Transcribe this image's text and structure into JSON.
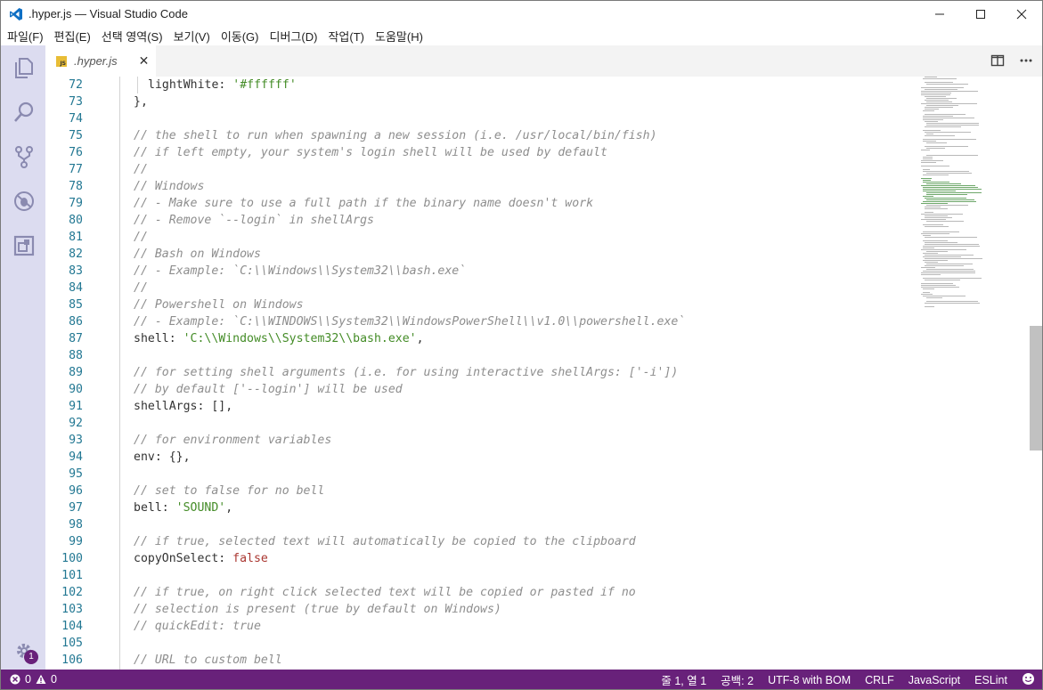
{
  "window": {
    "title": ".hyper.js — Visual Studio Code",
    "controls": [
      "minimize",
      "maximize",
      "close"
    ]
  },
  "menu": {
    "items": [
      "파일(F)",
      "편집(E)",
      "선택 영역(S)",
      "보기(V)",
      "이동(G)",
      "디버그(D)",
      "작업(T)",
      "도움말(H)"
    ]
  },
  "activity_bar": {
    "icons": [
      "explorer-icon",
      "search-icon",
      "source-control-icon",
      "debug-icon",
      "extensions-icon"
    ],
    "settings_badge": "1"
  },
  "tabs": [
    {
      "label": ".hyper.js",
      "icon": "JS",
      "close": "✕"
    }
  ],
  "editor": {
    "lines": [
      {
        "n": "72",
        "tokens": [
          [
            "key",
            "lightWhite"
          ],
          [
            "punct",
            ": "
          ],
          [
            "string",
            "'#ffffff'"
          ]
        ],
        "indent": 2
      },
      {
        "n": "73",
        "tokens": [
          [
            "punct",
            "},"
          ]
        ]
      },
      {
        "n": "74",
        "tokens": []
      },
      {
        "n": "75",
        "tokens": [
          [
            "comment",
            "// the shell to run when spawning a new session (i.e. /usr/local/bin/fish)"
          ]
        ]
      },
      {
        "n": "76",
        "tokens": [
          [
            "comment",
            "// if left empty, your system's login shell will be used by default"
          ]
        ]
      },
      {
        "n": "77",
        "tokens": [
          [
            "comment",
            "//"
          ]
        ]
      },
      {
        "n": "78",
        "tokens": [
          [
            "comment",
            "// Windows"
          ]
        ]
      },
      {
        "n": "79",
        "tokens": [
          [
            "comment",
            "// - Make sure to use a full path if the binary name doesn't work"
          ]
        ]
      },
      {
        "n": "80",
        "tokens": [
          [
            "comment",
            "// - Remove `--login` in shellArgs"
          ]
        ]
      },
      {
        "n": "81",
        "tokens": [
          [
            "comment",
            "//"
          ]
        ]
      },
      {
        "n": "82",
        "tokens": [
          [
            "comment",
            "// Bash on Windows"
          ]
        ]
      },
      {
        "n": "83",
        "tokens": [
          [
            "comment",
            "// - Example: `C:\\\\Windows\\\\System32\\\\bash.exe`"
          ]
        ]
      },
      {
        "n": "84",
        "tokens": [
          [
            "comment",
            "//"
          ]
        ]
      },
      {
        "n": "85",
        "tokens": [
          [
            "comment",
            "// Powershell on Windows"
          ]
        ]
      },
      {
        "n": "86",
        "tokens": [
          [
            "comment",
            "// - Example: `C:\\\\WINDOWS\\\\System32\\\\WindowsPowerShell\\\\v1.0\\\\powershell.exe`"
          ]
        ]
      },
      {
        "n": "87",
        "tokens": [
          [
            "key",
            "shell"
          ],
          [
            "punct",
            ": "
          ],
          [
            "string",
            "'C:\\\\Windows\\\\System32\\\\bash.exe'"
          ],
          [
            "punct",
            ","
          ]
        ]
      },
      {
        "n": "88",
        "tokens": []
      },
      {
        "n": "89",
        "tokens": [
          [
            "comment",
            "// for setting shell arguments (i.e. for using interactive shellArgs: ['-i'])"
          ]
        ]
      },
      {
        "n": "90",
        "tokens": [
          [
            "comment",
            "// by default ['--login'] will be used"
          ]
        ]
      },
      {
        "n": "91",
        "tokens": [
          [
            "key",
            "shellArgs"
          ],
          [
            "punct",
            ": [],"
          ]
        ]
      },
      {
        "n": "92",
        "tokens": []
      },
      {
        "n": "93",
        "tokens": [
          [
            "comment",
            "// for environment variables"
          ]
        ]
      },
      {
        "n": "94",
        "tokens": [
          [
            "key",
            "env"
          ],
          [
            "punct",
            ": {},"
          ]
        ]
      },
      {
        "n": "95",
        "tokens": []
      },
      {
        "n": "96",
        "tokens": [
          [
            "comment",
            "// set to false for no bell"
          ]
        ]
      },
      {
        "n": "97",
        "tokens": [
          [
            "key",
            "bell"
          ],
          [
            "punct",
            ": "
          ],
          [
            "string",
            "'SOUND'"
          ],
          [
            "punct",
            ","
          ]
        ]
      },
      {
        "n": "98",
        "tokens": []
      },
      {
        "n": "99",
        "tokens": [
          [
            "comment",
            "// if true, selected text will automatically be copied to the clipboard"
          ]
        ]
      },
      {
        "n": "100",
        "tokens": [
          [
            "key",
            "copyOnSelect"
          ],
          [
            "punct",
            ": "
          ],
          [
            "bool",
            "false"
          ]
        ]
      },
      {
        "n": "101",
        "tokens": []
      },
      {
        "n": "102",
        "tokens": [
          [
            "comment",
            "// if true, on right click selected text will be copied or pasted if no"
          ]
        ]
      },
      {
        "n": "103",
        "tokens": [
          [
            "comment",
            "// selection is present (true by default on Windows)"
          ]
        ]
      },
      {
        "n": "104",
        "tokens": [
          [
            "comment",
            "// quickEdit: true"
          ]
        ]
      },
      {
        "n": "105",
        "tokens": []
      },
      {
        "n": "106",
        "tokens": [
          [
            "comment",
            "// URL to custom bell"
          ]
        ]
      }
    ]
  },
  "status_bar": {
    "errors": "0",
    "warnings": "0",
    "position": "줄 1, 열 1",
    "indent": "공백: 2",
    "encoding": "UTF-8 with BOM",
    "eol": "CRLF",
    "language": "JavaScript",
    "linter": "ESLint",
    "feedback_icon": "smiley-icon"
  },
  "colors": {
    "status_bar": "#68217a",
    "activity_bar": "#dcdcf0",
    "comment": "#8e8e8e",
    "string": "#448c27",
    "boolean": "#aa3731",
    "line_number": "#237893"
  }
}
